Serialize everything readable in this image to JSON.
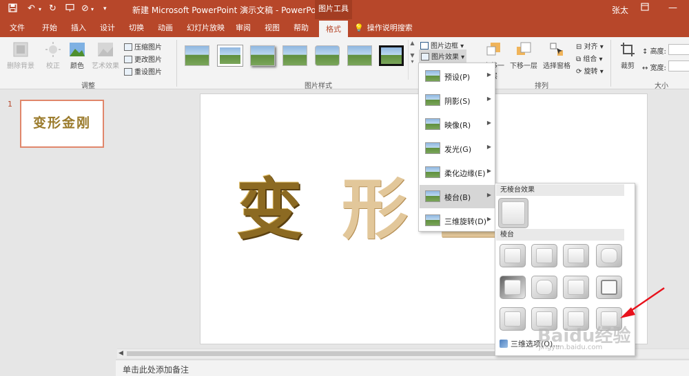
{
  "quick_access": {
    "save_icon": "save-icon",
    "undo_icon": "undo-icon",
    "redo_icon": "redo-icon",
    "present_icon": "present-icon",
    "custom_icon": "customize-icon"
  },
  "titlebar": {
    "title": "新建 Microsoft PowerPoint 演示文稿 - PowerPoint",
    "context_tool": "图片工具",
    "user": "张太"
  },
  "tabs": [
    {
      "label": "文件"
    },
    {
      "label": "开始"
    },
    {
      "label": "插入"
    },
    {
      "label": "设计"
    },
    {
      "label": "切换"
    },
    {
      "label": "动画"
    },
    {
      "label": "幻灯片放映"
    },
    {
      "label": "审阅"
    },
    {
      "label": "视图"
    },
    {
      "label": "帮助"
    },
    {
      "label": "格式"
    }
  ],
  "tell_me": "操作说明搜索",
  "ribbon": {
    "adjust": {
      "remove_bg": "删除背景",
      "corrections": "校正",
      "color": "颜色",
      "artistic": "艺术效果",
      "compress": "压缩图片",
      "change": "更改图片",
      "reset": "重设图片",
      "label": "调整"
    },
    "styles": {
      "label": "图片样式",
      "border": "图片边框",
      "effects": "图片效果"
    },
    "arrange": {
      "bring_forward": "上移一层",
      "send_backward": "下移一层",
      "selection_pane": "选择窗格",
      "align": "对齐",
      "group": "组合",
      "rotate": "旋转",
      "label": "排列"
    },
    "size": {
      "crop": "裁剪",
      "height": "高度:",
      "width": "宽度:",
      "label": "大小"
    }
  },
  "slides": {
    "number": "1",
    "thumb_text": "变形金刚"
  },
  "slide_content": {
    "char1": "变",
    "char2": "形",
    "char3": "金"
  },
  "effects_menu": {
    "items": [
      {
        "label": "预设(P)"
      },
      {
        "label": "阴影(S)"
      },
      {
        "label": "映像(R)"
      },
      {
        "label": "发光(G)"
      },
      {
        "label": "柔化边缘(E)"
      },
      {
        "label": "棱台(B)"
      },
      {
        "label": "三维旋转(D)"
      }
    ]
  },
  "bevel_menu": {
    "no_bevel_header": "无棱台效果",
    "bevel_header": "棱台",
    "options": "三维选项(O)..."
  },
  "notes": {
    "placeholder": "单击此处添加备注"
  },
  "watermark": {
    "main": "Baidu经验",
    "sub": "jingyan.baidu.com"
  }
}
